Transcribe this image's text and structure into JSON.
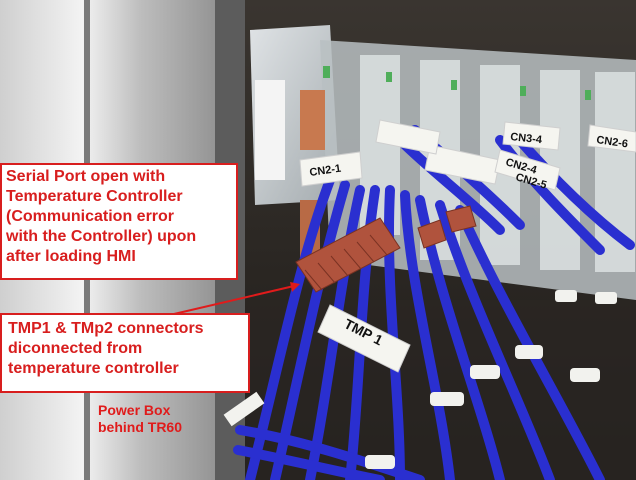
{
  "annotations": {
    "serial_port_lines": [
      "Serial Port open with",
      "Temperature Controller",
      "(Communication error",
      "with the Controller) upon",
      "after loading HMI"
    ],
    "tmp_connectors_lines": [
      "TMP1 & TMp2 connectors",
      "diconnected from",
      "temperature controller"
    ],
    "power_box_lines": [
      "Power Box",
      "behind TR60"
    ]
  },
  "wire_labels": {
    "tmp1": "TMP 1",
    "cn2_1": "CN2-1",
    "cn2_4": "CN2-4",
    "cn2_5": "CN2-5",
    "cn3_4": "CN3-4",
    "cn2_6": "CN2-6"
  },
  "colors": {
    "annotation_red": "#d81e1e",
    "wire_blue": "#2a2fd0",
    "connector_brown": "#b0533d"
  }
}
